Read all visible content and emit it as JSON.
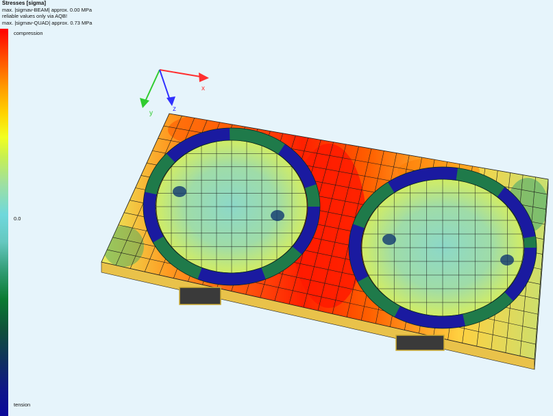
{
  "header": {
    "title": "Stresses [sigma]",
    "line1": "max. |sigmav-BEAM| approx. 0.00 MPa",
    "line2": "reliable values only via AQB!",
    "line3": "max. |sigmav-QUAD| approx. 0.73 MPa"
  },
  "legend": {
    "top": "compression",
    "middle": "0.0",
    "bottom": "tension"
  },
  "axes": {
    "x": "x",
    "y": "y",
    "z": "z"
  },
  "colors": {
    "background": "#e6f4fb",
    "compression": "#ff0000",
    "tension": "#0a0a9a",
    "ring_beam": "#1a1aa0",
    "ring_green": "#1f7a4a",
    "axis_x": "#ff3030",
    "axis_y": "#30cc30",
    "axis_z": "#3030ff"
  }
}
